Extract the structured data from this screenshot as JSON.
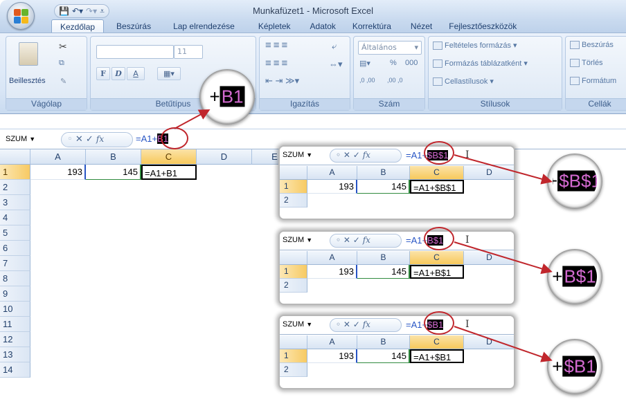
{
  "window": {
    "title": "Munkafüzet1 - Microsoft Excel"
  },
  "ribbon_tabs": [
    "Kezdőlap",
    "Beszúrás",
    "Lap elrendezése",
    "Képletek",
    "Adatok",
    "Korrektúra",
    "Nézet",
    "Fejlesztőeszközök"
  ],
  "clipboard": {
    "paste_label": "Beillesztés",
    "group_label": "Vágólap"
  },
  "font": {
    "size": "11",
    "bold": "F",
    "italic": "D",
    "underline": "A",
    "group_label": "Betűtípus"
  },
  "alignment": {
    "group_label": "Igazítás"
  },
  "number": {
    "format": "Általános",
    "percent": "%",
    "thousands": "000",
    "dec_inc": ",0 ,00",
    "dec_dec": ",00 ,0",
    "group_label": "Szám"
  },
  "styles": {
    "conditional": "Feltételes formázás",
    "format_table": "Formázás táblázatként",
    "cell_styles": "Cellastílusok",
    "group_label": "Stílusok"
  },
  "cells": {
    "insert": "Beszúrás",
    "delete": "Törlés",
    "format": "Formátum",
    "group_label": "Cellák"
  },
  "formula_bar": {
    "name_box": "SZUM",
    "cancel": "✕",
    "enter": "✓",
    "fx": "fx",
    "prefix": "=A1+",
    "highlight": "B1"
  },
  "magnifier_main": {
    "plus": "+",
    "highlight": "B1"
  },
  "sheet": {
    "columns": [
      "A",
      "B",
      "C",
      "D",
      "E"
    ],
    "rows": [
      "1",
      "2",
      "3",
      "4",
      "5",
      "6",
      "7",
      "8",
      "9",
      "10",
      "11",
      "12",
      "13",
      "14"
    ],
    "a1": "193",
    "b1": "145",
    "c1": "=A1+B1"
  },
  "popups": [
    {
      "name_box": "SZUM",
      "prefix": "=A1+",
      "highlight": "$B$1",
      "columns": [
        "A",
        "B",
        "C",
        "D"
      ],
      "rows": [
        "1",
        "2"
      ],
      "a1": "193",
      "b1": "145",
      "c1": "=A1+$B$1",
      "magnifier": "$B$1",
      "magnifier_plus": "+"
    },
    {
      "name_box": "SZUM",
      "prefix": "=A1+",
      "highlight": "B$1",
      "columns": [
        "A",
        "B",
        "C",
        "D"
      ],
      "rows": [
        "1",
        "2"
      ],
      "a1": "193",
      "b1": "145",
      "c1": "=A1+B$1",
      "magnifier": "B$1",
      "magnifier_plus": "+"
    },
    {
      "name_box": "SZUM",
      "prefix": "=A1+",
      "highlight": "$B1",
      "columns": [
        "A",
        "B",
        "C",
        "D"
      ],
      "rows": [
        "1",
        "2"
      ],
      "a1": "193",
      "b1": "145",
      "c1": "=A1+$B1",
      "magnifier": "$B1",
      "magnifier_plus": "+"
    }
  ],
  "colors": {
    "accent": "#c0262c",
    "highlight_bg": "#000000",
    "highlight_fg": "#d36ad0",
    "ref_blue": "#2654c4",
    "selected_header": "#f7c95c"
  }
}
